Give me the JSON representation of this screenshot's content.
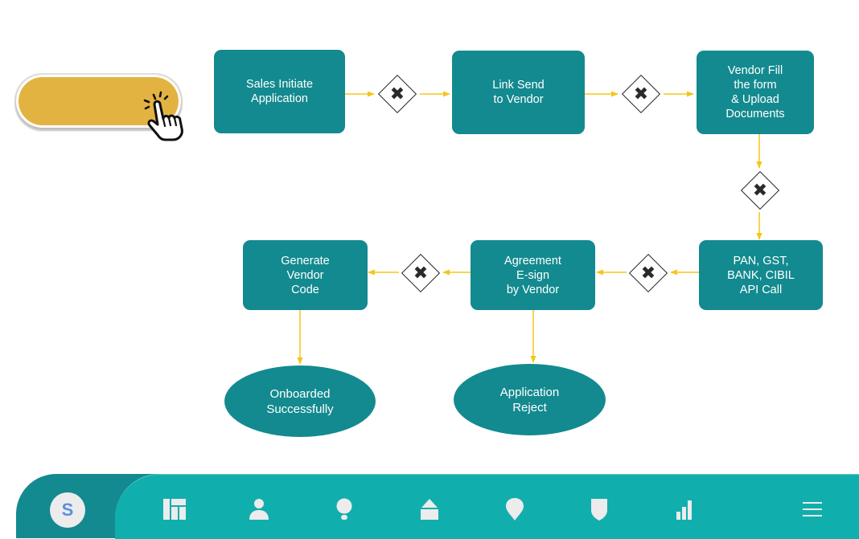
{
  "colors": {
    "node_fill": "#138a8f",
    "node_text": "#ffffff",
    "arrow": "#f5c518",
    "start_button": "#e3b342",
    "nav_bar": "#11aeae",
    "nav_bar_dark": "#138a8f",
    "nav_icon": "#ececec",
    "avatar_text": "#5b8fe0"
  },
  "start_button": {
    "label": "",
    "icon": "hand-pointer-click-icon"
  },
  "nodes": {
    "sales_initiate": "Sales Initiate\nApplication",
    "link_send": "Link Send\nto Vendor",
    "vendor_fill": "Vendor Fill\nthe form\n& Upload\nDocuments",
    "api_call": "PAN, GST,\nBANK, CIBIL\nAPI Call",
    "agreement": "Agreement\nE-sign\nby Vendor",
    "generate_code": "Generate\nVendor\nCode",
    "onboarded": "Onboarded\nSuccessfully",
    "reject": "Application\nReject"
  },
  "gateway": {
    "symbol": "✖",
    "type": "exclusive-gateway"
  },
  "flows": [
    {
      "from": "sales_initiate",
      "to": "gateway_1"
    },
    {
      "from": "gateway_1",
      "to": "link_send"
    },
    {
      "from": "link_send",
      "to": "gateway_2"
    },
    {
      "from": "gateway_2",
      "to": "vendor_fill"
    },
    {
      "from": "vendor_fill",
      "to": "gateway_3"
    },
    {
      "from": "gateway_3",
      "to": "api_call"
    },
    {
      "from": "api_call",
      "to": "gateway_4"
    },
    {
      "from": "gateway_4",
      "to": "agreement"
    },
    {
      "from": "agreement",
      "to": "gateway_5"
    },
    {
      "from": "gateway_5",
      "to": "generate_code"
    },
    {
      "from": "generate_code",
      "to": "onboarded"
    },
    {
      "from": "agreement",
      "to": "reject"
    }
  ],
  "navbar": {
    "avatar_letter": "S",
    "items": [
      {
        "name": "dashboard",
        "icon": "dashboard-icon"
      },
      {
        "name": "user",
        "icon": "user-icon"
      },
      {
        "name": "ideas",
        "icon": "lightbulb-icon"
      },
      {
        "name": "upload",
        "icon": "upload-icon"
      },
      {
        "name": "location",
        "icon": "map-pin-icon"
      },
      {
        "name": "security",
        "icon": "shield-icon"
      },
      {
        "name": "analytics",
        "icon": "bar-chart-icon"
      },
      {
        "name": "menu",
        "icon": "hamburger-menu-icon"
      }
    ]
  }
}
